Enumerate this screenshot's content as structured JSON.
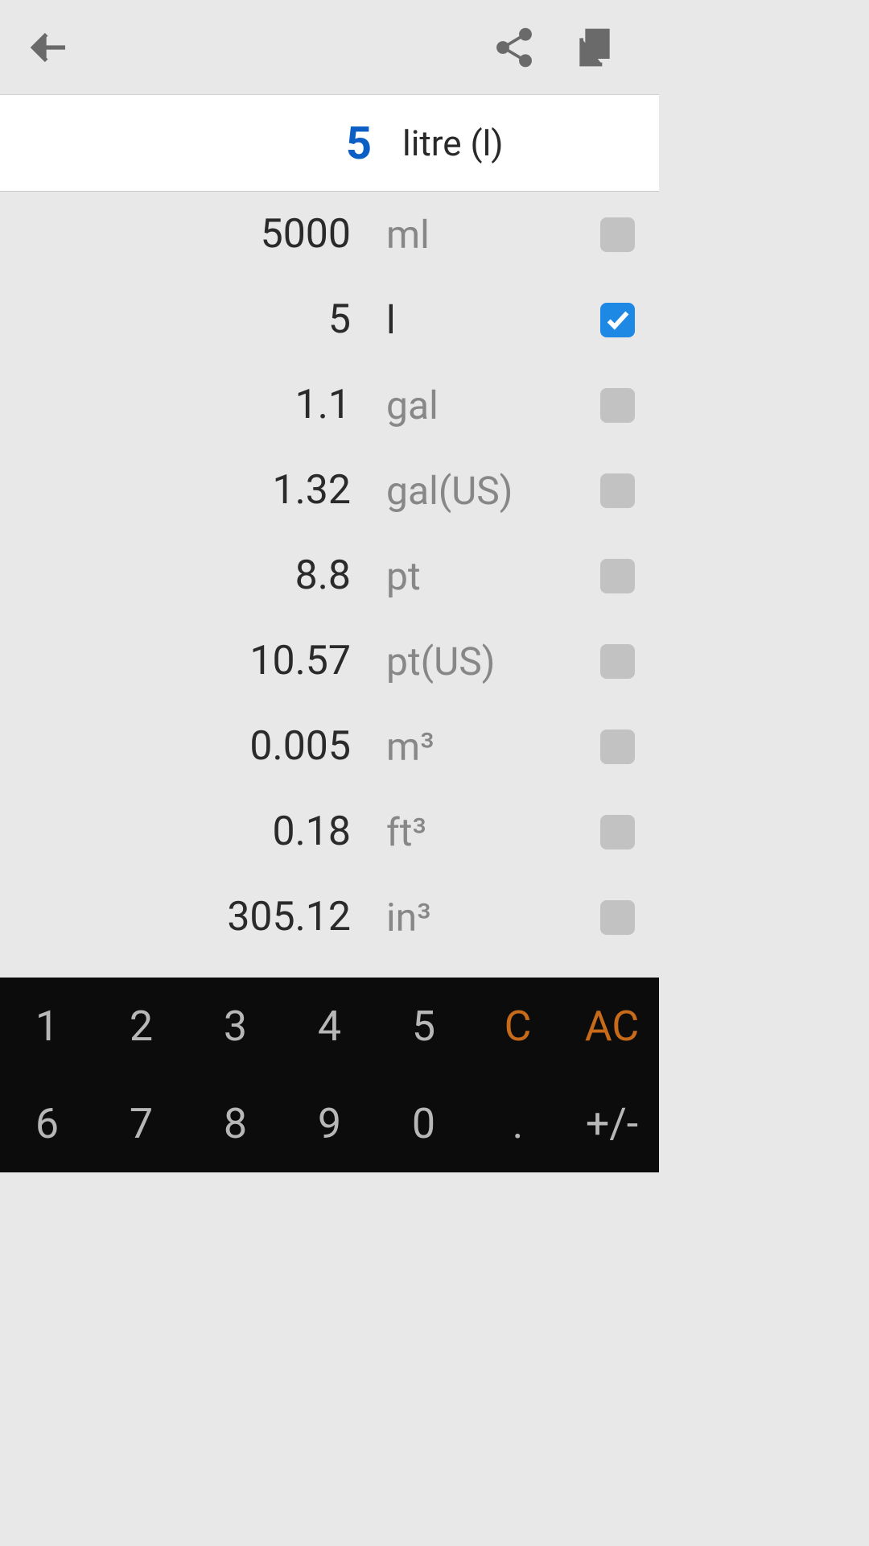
{
  "input": {
    "value": "5",
    "unit": "litre (l)"
  },
  "results": [
    {
      "value": "5000",
      "unit": "ml",
      "checked": false
    },
    {
      "value": "5",
      "unit": "l",
      "checked": true
    },
    {
      "value": "1.1",
      "unit": "gal",
      "checked": false
    },
    {
      "value": "1.32",
      "unit": "gal(US)",
      "checked": false
    },
    {
      "value": "8.8",
      "unit": "pt",
      "checked": false
    },
    {
      "value": "10.57",
      "unit": "pt(US)",
      "checked": false
    },
    {
      "value": "0.005",
      "unit": "m³",
      "checked": false
    },
    {
      "value": "0.18",
      "unit": "ft³",
      "checked": false
    },
    {
      "value": "305.12",
      "unit": "in³",
      "checked": false
    }
  ],
  "keypad": {
    "row1": [
      "1",
      "2",
      "3",
      "4",
      "5",
      "C",
      "AC"
    ],
    "row2": [
      "6",
      "7",
      "8",
      "9",
      "0",
      ".",
      "+/-"
    ]
  }
}
